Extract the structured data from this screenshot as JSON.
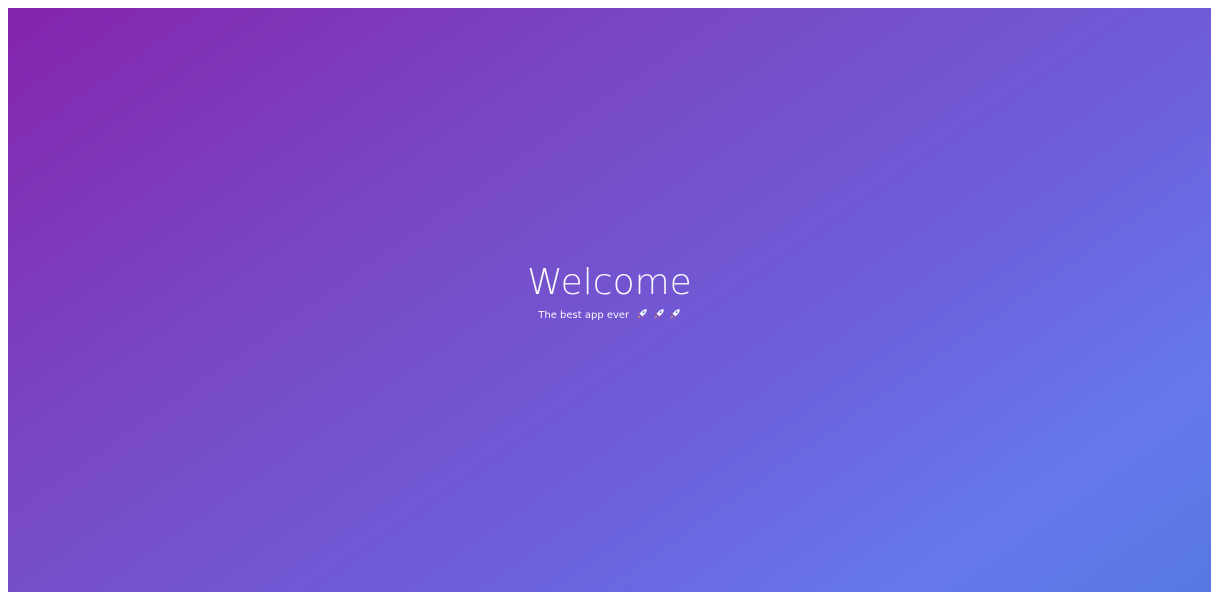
{
  "hero": {
    "title": "Welcome",
    "subtitle": "The best app ever",
    "icons": [
      "rocket-icon",
      "rocket-icon",
      "rocket-icon"
    ]
  },
  "colors": {
    "gradient_start": "#8424ad",
    "gradient_mid": "#6f5cd8",
    "gradient_end": "#6578ec",
    "text": "#ffffff"
  }
}
